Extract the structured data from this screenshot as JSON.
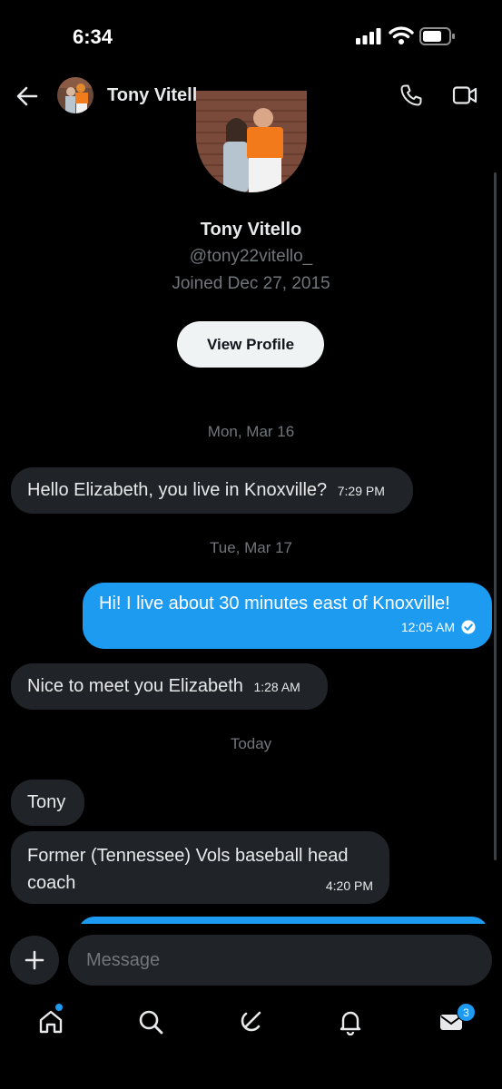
{
  "status_bar": {
    "time": "6:34"
  },
  "header": {
    "name": "Tony Vitello"
  },
  "profile": {
    "name": "Tony Vitello",
    "handle": "@tony22vitello_",
    "joined": "Joined Dec 27, 2015",
    "view_profile_label": "View Profile"
  },
  "conversation": {
    "date_1": "Mon, Mar 16",
    "date_2": "Tue, Mar 17",
    "date_3": "Today",
    "messages": [
      {
        "text": "Hello Elizabeth, you live in Knoxville?",
        "time": "7:29 PM",
        "direction": "incoming"
      },
      {
        "text": "Hi! I live about 30 minutes east of Knoxville!",
        "time": "12:05 AM",
        "direction": "outgoing",
        "status": "read"
      },
      {
        "text": "Nice to meet you Elizabeth",
        "time": "1:28 AM",
        "direction": "incoming"
      },
      {
        "text": "Tony",
        "time": "",
        "direction": "incoming"
      },
      {
        "text": "Former (Tennessee)  Vols baseball head coach",
        "time": "4:20 PM",
        "direction": "incoming"
      }
    ]
  },
  "composer": {
    "placeholder": "Message"
  },
  "bottom_nav": {
    "items": [
      "home-icon",
      "search-icon",
      "grok-icon",
      "bell-icon",
      "mail-icon"
    ],
    "messages_badge": "3"
  },
  "colors": {
    "accent": "#1d9bf0",
    "bubble_incoming": "#202327",
    "background": "#000000"
  }
}
